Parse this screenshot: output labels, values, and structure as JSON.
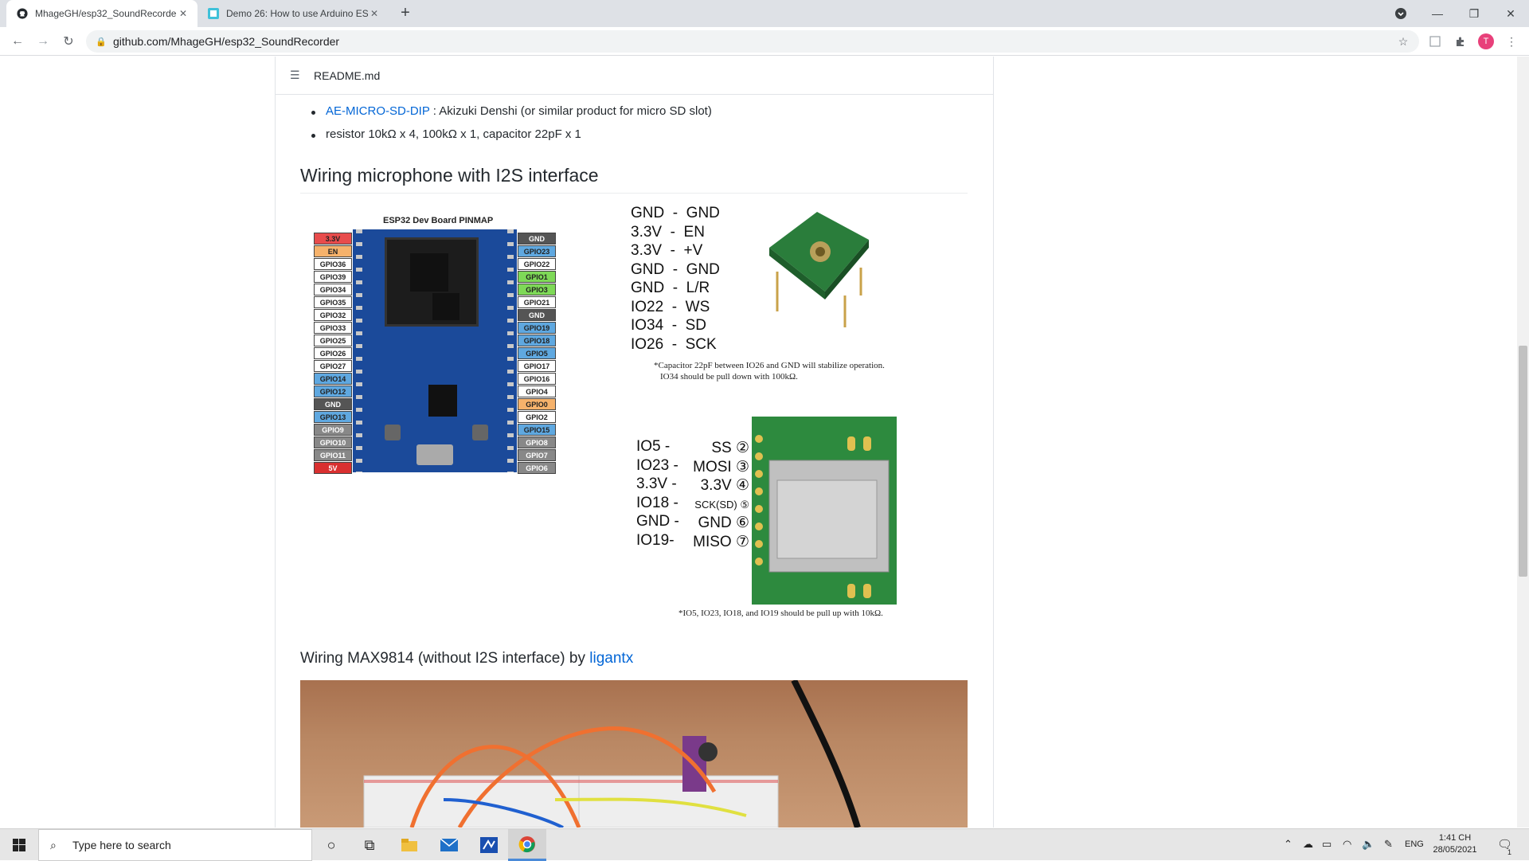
{
  "browser": {
    "tabs": [
      {
        "title": "MhageGH/esp32_SoundRecorde",
        "active": true
      },
      {
        "title": "Demo 26: How to use Arduino ES",
        "active": false
      }
    ],
    "url": "github.com/MhageGH/esp32_SoundRecorder",
    "avatar_letter": "T"
  },
  "readme": {
    "filename": "README.md",
    "items": [
      {
        "link": "AE-MICRO-SD-DIP",
        "text": " : Akizuki Denshi (or similar product for micro SD slot)"
      },
      {
        "text": "resistor 10kΩ x 4, 100kΩ x 1, capacitor 22pF x 1"
      }
    ],
    "section_title": "Wiring microphone with I2S interface",
    "board_title": "ESP32 Dev Board PINMAP",
    "left_pins": [
      "3.3V",
      "EN",
      "GPIO36",
      "GPIO39",
      "GPIO34",
      "GPIO35",
      "GPIO32",
      "GPIO33",
      "GPIO25",
      "GPIO26",
      "GPIO27",
      "GPIO14",
      "GPIO12",
      "GND",
      "GPIO13",
      "GPIO9",
      "GPIO10",
      "GPIO11",
      "5V"
    ],
    "left_pin_colors": [
      "#e84c4c",
      "#f6b26b",
      "#ffffff",
      "#ffffff",
      "#ffffff",
      "#ffffff",
      "#ffffff",
      "#ffffff",
      "#ffffff",
      "#ffffff",
      "#ffffff",
      "#5fa8e0",
      "#5fa8e0",
      "#555555",
      "#5fa8e0",
      "#888888",
      "#888888",
      "#888888",
      "#d93030"
    ],
    "right_pins": [
      "GND",
      "GPIO23",
      "GPIO22",
      "GPIO1",
      "GPIO3",
      "GPIO21",
      "GND",
      "GPIO19",
      "GPIO18",
      "GPIO5",
      "GPIO17",
      "GPIO16",
      "GPIO4",
      "GPIO0",
      "GPIO2",
      "GPIO15",
      "GPIO8",
      "GPIO7",
      "GPIO6"
    ],
    "right_pin_colors": [
      "#555555",
      "#5fa8e0",
      "#ffffff",
      "#7ed957",
      "#7ed957",
      "#ffffff",
      "#555555",
      "#5fa8e0",
      "#5fa8e0",
      "#5fa8e0",
      "#ffffff",
      "#ffffff",
      "#ffffff",
      "#f6b26b",
      "#ffffff",
      "#5fa8e0",
      "#888888",
      "#888888",
      "#888888"
    ],
    "mic_wiring": [
      "GND  -  GND",
      "3.3V  -  EN",
      "3.3V  -  +V",
      "GND  -  GND",
      "GND  -  L/R",
      "IO22  -  WS",
      "IO34  -  SD",
      "IO26  -  SCK"
    ],
    "mic_note_line1": "*Capacitor 22pF between IO26 and GND will stabilize operation.",
    "mic_note_line2": "IO34 should be pull down with 100kΩ.",
    "sd_wiring_left": [
      "IO5 -",
      "IO23 -",
      "3.3V -",
      "IO18 -",
      "GND -",
      "IO19-"
    ],
    "sd_wiring_right": [
      "SS ②",
      "MOSI ③",
      "3.3V ④",
      "SCK(SD) ⑤",
      "GND ⑥",
      "MISO ⑦"
    ],
    "sd_note": "*IO5, IO23, IO18, and IO19 should be pull up with 10kΩ.",
    "subsection_prefix": "Wiring MAX9814 (without I2S interface) by ",
    "subsection_link": "ligantx"
  },
  "taskbar": {
    "search_placeholder": "Type here to search",
    "lang": "ENG",
    "time": "1:41 CH",
    "date": "28/05/2021",
    "notification_count": "1"
  },
  "colors": {
    "link": "#0366d6",
    "github_text": "#24292e"
  }
}
